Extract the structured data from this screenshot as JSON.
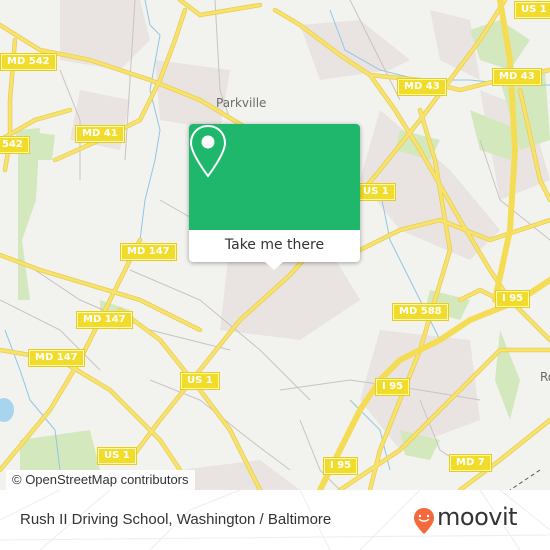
{
  "map": {
    "place_labels": [
      {
        "name": "Parkville"
      },
      {
        "name": "Ro"
      }
    ],
    "route_shields": [
      {
        "id": "md542-a",
        "label": "MD 542"
      },
      {
        "id": "md542-b",
        "label": "542"
      },
      {
        "id": "md41",
        "label": "MD 41"
      },
      {
        "id": "us1-top",
        "label": "US 1"
      },
      {
        "id": "md43-a",
        "label": "MD 43"
      },
      {
        "id": "md43-b",
        "label": "MD 43"
      },
      {
        "id": "us1-mid",
        "label": "US 1"
      },
      {
        "id": "md147-a",
        "label": "MD 147"
      },
      {
        "id": "md147-b",
        "label": "MD 147"
      },
      {
        "id": "md147-c",
        "label": "MD 147"
      },
      {
        "id": "md588",
        "label": "MD 588"
      },
      {
        "id": "i95-a",
        "label": "I 95"
      },
      {
        "id": "us1-low",
        "label": "US 1"
      },
      {
        "id": "i95-b",
        "label": "I 95"
      },
      {
        "id": "us1-bottom",
        "label": "US 1"
      },
      {
        "id": "i95-c",
        "label": "I 95"
      },
      {
        "id": "md7",
        "label": "MD 7"
      }
    ],
    "attribution": "© OpenStreetMap contributors",
    "colors": {
      "land": "#f2f2ef",
      "road": "#f7e06a",
      "water": "#8fc8e8",
      "park": "#d2e8b8",
      "urban": "#e8e2df"
    }
  },
  "popup": {
    "button_label": "Take me there",
    "icon": "map-pin-icon",
    "color": "#1eb76b"
  },
  "footer": {
    "title": "Rush II Driving School, Washington / Baltimore",
    "brand": "moovit",
    "brand_icon": "moovit-pin-icon",
    "brand_color": "#f26a3b"
  }
}
